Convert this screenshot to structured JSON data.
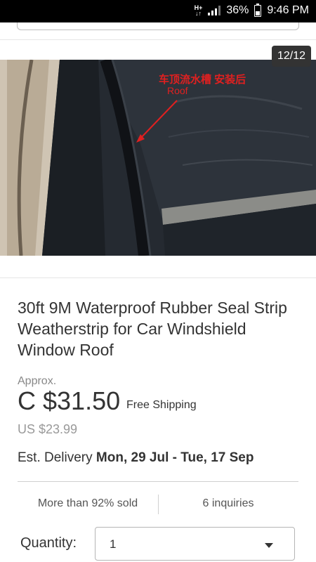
{
  "status_bar": {
    "network_top": "H+",
    "network_bottom": "↓↑",
    "battery": "36%",
    "time": "9:46 PM",
    "icons": [
      "signal-icon",
      "battery-icon"
    ]
  },
  "gallery": {
    "counter": "12/12",
    "photo_annotation_cn": "车顶流水槽 安装后",
    "photo_annotation_en": "Roof",
    "annotation_color": "#e02020"
  },
  "listing": {
    "title": "30ft 9M Waterproof Rubber Seal Strip Weatherstrip for Car Windshield Window Roof",
    "approx_label": "Approx.",
    "price": "C $31.50",
    "shipping": "Free Shipping",
    "us_price": "US $23.99",
    "delivery_label": "Est. Delivery",
    "delivery_dates": "Mon, 29 Jul - Tue, 17 Sep",
    "sold_text": "More than 92% sold",
    "inquiries_text": "6 inquiries"
  },
  "quantity": {
    "label": "Quantity:",
    "value": "1",
    "icon": "dropdown-arrow-icon"
  }
}
